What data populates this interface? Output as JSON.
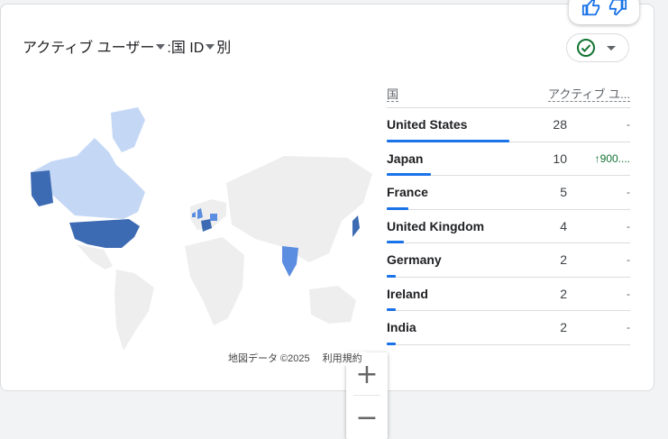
{
  "card": {
    "title_prefix": "アクティブ ユーザー",
    "title_mid": ":国 ID",
    "title_suffix": "別"
  },
  "map": {
    "zoom_in": "+",
    "zoom_out": "−",
    "attribution_data": "地図データ ©2025",
    "attribution_terms": "利用規約",
    "highlight_colors": {
      "high": "#3d6bb3",
      "mid": "#5b8de0",
      "low": "#c4d7f5",
      "base": "#eeeeee"
    }
  },
  "table": {
    "col_country": "国",
    "col_users": "アクティブ ユ...",
    "max_value": 28,
    "rows": [
      {
        "country": "United States",
        "value": "28",
        "change": "-",
        "change_up": false,
        "num": 28
      },
      {
        "country": "Japan",
        "value": "10",
        "change": "900....",
        "change_up": true,
        "num": 10
      },
      {
        "country": "France",
        "value": "5",
        "change": "-",
        "change_up": false,
        "num": 5
      },
      {
        "country": "United Kingdom",
        "value": "4",
        "change": "-",
        "change_up": false,
        "num": 4
      },
      {
        "country": "Germany",
        "value": "2",
        "change": "-",
        "change_up": false,
        "num": 2
      },
      {
        "country": "Ireland",
        "value": "2",
        "change": "-",
        "change_up": false,
        "num": 2
      },
      {
        "country": "India",
        "value": "2",
        "change": "-",
        "change_up": false,
        "num": 2
      }
    ]
  }
}
